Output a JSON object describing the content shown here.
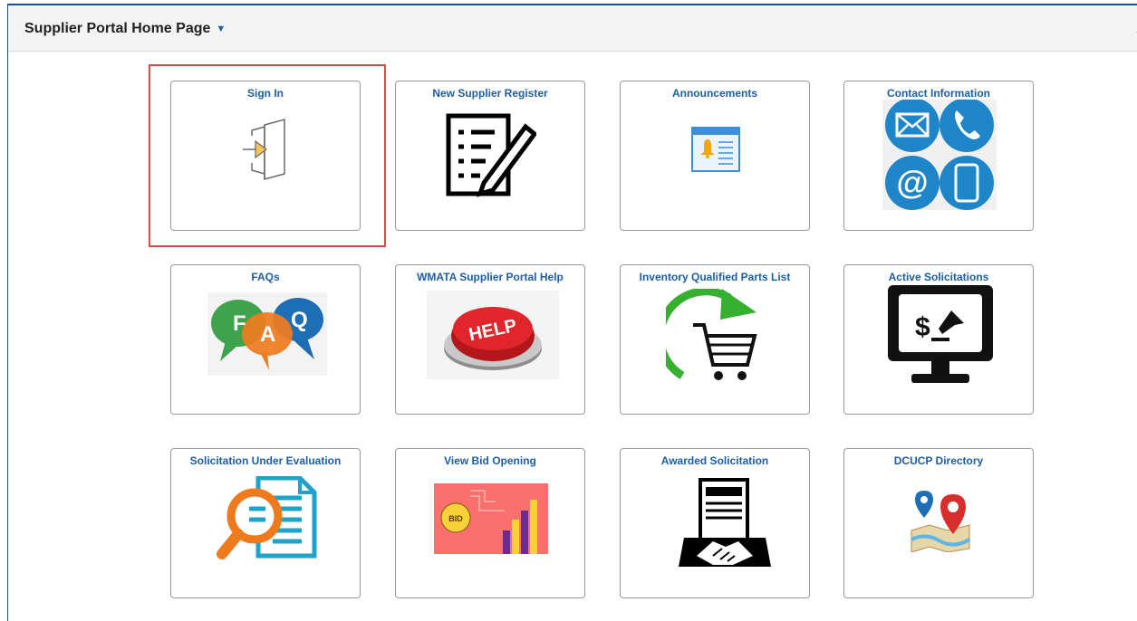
{
  "header": {
    "title": "Supplier Portal Home Page"
  },
  "tiles": [
    {
      "label": "Sign In",
      "icon": "sign-in-door-icon"
    },
    {
      "label": "New Supplier Register",
      "icon": "registration-form-icon"
    },
    {
      "label": "Announcements",
      "icon": "announcement-bell-icon"
    },
    {
      "label": "Contact Information",
      "icon": "contact-methods-icon"
    },
    {
      "label": "FAQs",
      "icon": "faq-speech-bubbles-icon"
    },
    {
      "label": "WMATA Supplier Portal Help",
      "icon": "help-button-icon",
      "icon_text": "HELP"
    },
    {
      "label": "Inventory Qualified Parts List",
      "icon": "cart-refresh-icon"
    },
    {
      "label": "Active Solicitations",
      "icon": "auction-monitor-icon",
      "icon_text": "$"
    },
    {
      "label": "Solicitation Under Evaluation",
      "icon": "document-magnifier-icon"
    },
    {
      "label": "View Bid Opening",
      "icon": "bid-chart-icon",
      "icon_text": "BID"
    },
    {
      "label": "Awarded Solicitation",
      "icon": "handshake-contract-icon"
    },
    {
      "label": "DCUCP Directory",
      "icon": "map-pins-icon"
    }
  ],
  "colors": {
    "accent": "#1c5ea3",
    "highlight": "#e0474b",
    "header_border": "#1f4e8c"
  }
}
